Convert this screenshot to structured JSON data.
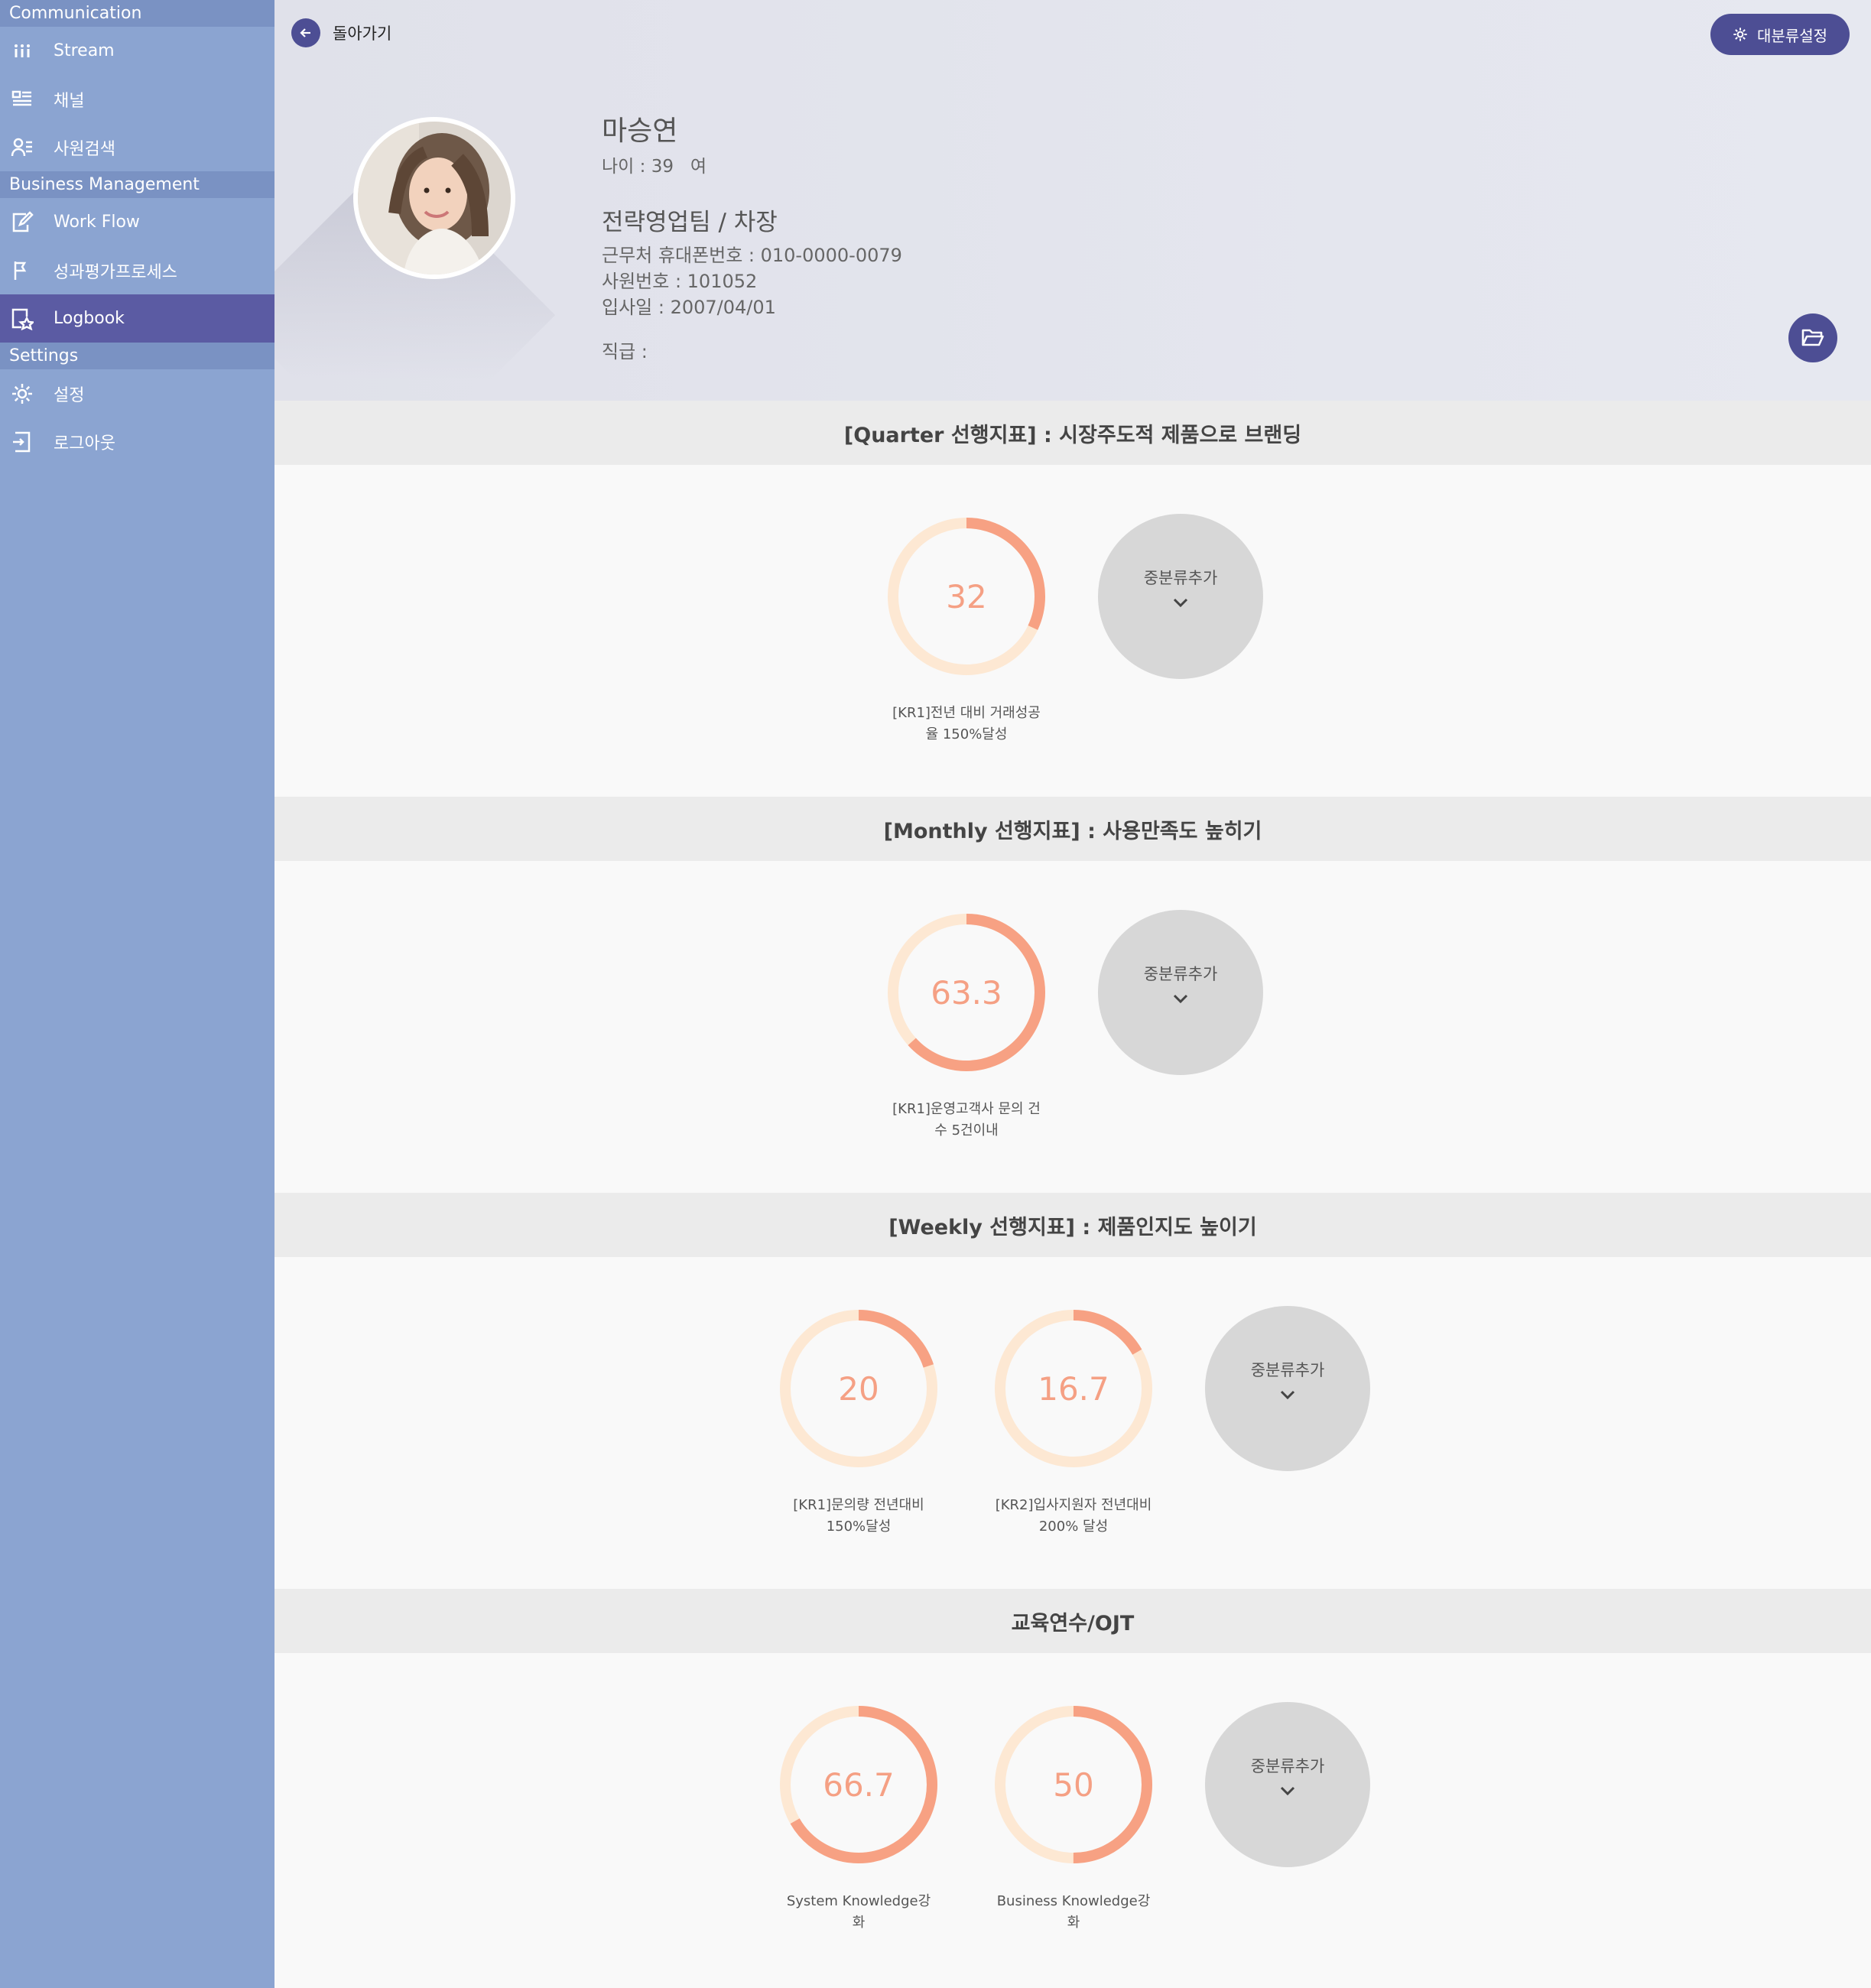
{
  "sidebar": {
    "sections": [
      {
        "title": "Communication",
        "items": [
          {
            "label": "Stream",
            "icon": "stream-icon"
          },
          {
            "label": "채널",
            "icon": "channel-icon"
          },
          {
            "label": "사원검색",
            "icon": "user-search-icon"
          }
        ]
      },
      {
        "title": "Business Management",
        "items": [
          {
            "label": "Work Flow",
            "icon": "edit-icon"
          },
          {
            "label": "성과평가프로세스",
            "icon": "flag-icon"
          },
          {
            "label": "Logbook",
            "icon": "logbook-icon",
            "active": true
          }
        ]
      },
      {
        "title": "Settings",
        "items": [
          {
            "label": "설정",
            "icon": "gear-icon"
          },
          {
            "label": "로그아웃",
            "icon": "logout-icon"
          }
        ]
      }
    ],
    "colors": {
      "background": "#8ba4d1",
      "header": "#7a92c3",
      "active": "#5b5ba3"
    }
  },
  "header": {
    "back_label": "돌아가기",
    "category_button": "대분류설정"
  },
  "profile": {
    "name": "마승연",
    "age_gender": "나이 : 39   여",
    "dept_title": "전략영업팀 / 차장",
    "phone": "근무처 휴대폰번호 : 010-0000-0079",
    "employee_no": "사원번호 : 101052",
    "join_date": "입사일 : 2007/04/01",
    "position": "직급 :"
  },
  "sections": [
    {
      "title": "[Quarter 선행지표] : 시장주도적 제품으로 브랜딩",
      "add_label": "중분류추가",
      "kpis": [
        {
          "value": 32,
          "display": "32",
          "label1": "[KR1]전년 대비 거래성공",
          "label2": "율 150%달성"
        }
      ]
    },
    {
      "title": "[Monthly 선행지표] : 사용만족도 높히기",
      "add_label": "중분류추가",
      "kpis": [
        {
          "value": 63.3,
          "display": "63.3",
          "label1": "[KR1]운영고객사 문의 건",
          "label2": "수 5건이내"
        }
      ]
    },
    {
      "title": "[Weekly 선행지표] : 제품인지도 높이기",
      "add_label": "중분류추가",
      "kpis": [
        {
          "value": 20,
          "display": "20",
          "label1": "[KR1]문의량 전년대비",
          "label2": "150%달성"
        },
        {
          "value": 16.7,
          "display": "16.7",
          "label1": "[KR2]입사지원자 전년대비",
          "label2": "200% 달성"
        }
      ]
    },
    {
      "title": "교육연수/OJT",
      "add_label": "중분류추가",
      "kpis": [
        {
          "value": 66.7,
          "display": "66.7",
          "label1": "System Knowledge강",
          "label2": "화"
        },
        {
          "value": 50,
          "display": "50",
          "label1": "Business Knowledge강",
          "label2": "화"
        }
      ]
    }
  ],
  "colors": {
    "accent": "#4d4e94",
    "progress": "#f7a183",
    "track": "#fde8d3",
    "add": "#d7d7d7"
  }
}
